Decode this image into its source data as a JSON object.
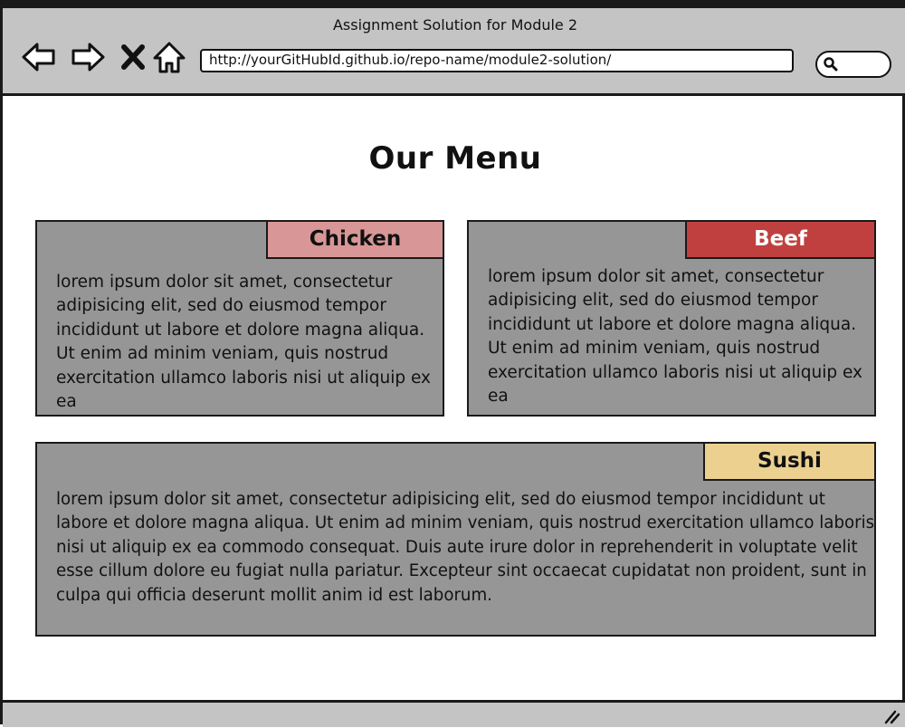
{
  "window": {
    "title": "Assignment Solution for Module 2"
  },
  "toolbar": {
    "back_icon": "back-arrow-icon",
    "forward_icon": "forward-arrow-icon",
    "stop_icon": "close-x-icon",
    "home_icon": "home-icon",
    "url": "http://yourGitHubId.github.io/repo-name/module2-solution/",
    "search_icon": "search-icon"
  },
  "page": {
    "title": "Our Menu"
  },
  "menu": {
    "chicken": {
      "label": "Chicken",
      "text": "lorem ipsum dolor sit amet, consectetur adipisicing elit, sed do eiusmod tempor incididunt ut labore et dolore magna aliqua. Ut enim ad minim veniam, quis nostrud exercitation ullamco laboris nisi ut aliquip ex ea",
      "label_color": "#d99696"
    },
    "beef": {
      "label": "Beef",
      "text": "lorem ipsum dolor sit amet, consectetur adipisicing elit, sed do eiusmod tempor incididunt ut labore et dolore magna aliqua. Ut enim ad minim veniam, quis nostrud exercitation ullamco laboris nisi ut aliquip ex ea",
      "label_color": "#c0403f"
    },
    "sushi": {
      "label": "Sushi",
      "text": "lorem ipsum dolor sit amet, consectetur adipisicing elit, sed do eiusmod tempor incididunt ut labore et dolore magna aliqua. Ut enim ad minim veniam, quis nostrud exercitation ullamco laboris nisi ut aliquip ex ea commodo consequat. Duis aute irure dolor in reprehenderit in voluptate velit esse cillum dolore eu fugiat nulla pariatur. Excepteur sint occaecat cupidatat non proident, sunt in culpa qui officia deserunt mollit anim id est laborum.",
      "label_color": "#ebd08f"
    },
    "card_color": "#969696"
  },
  "statusbar": {
    "resize_icon": "resize-handle-icon"
  }
}
